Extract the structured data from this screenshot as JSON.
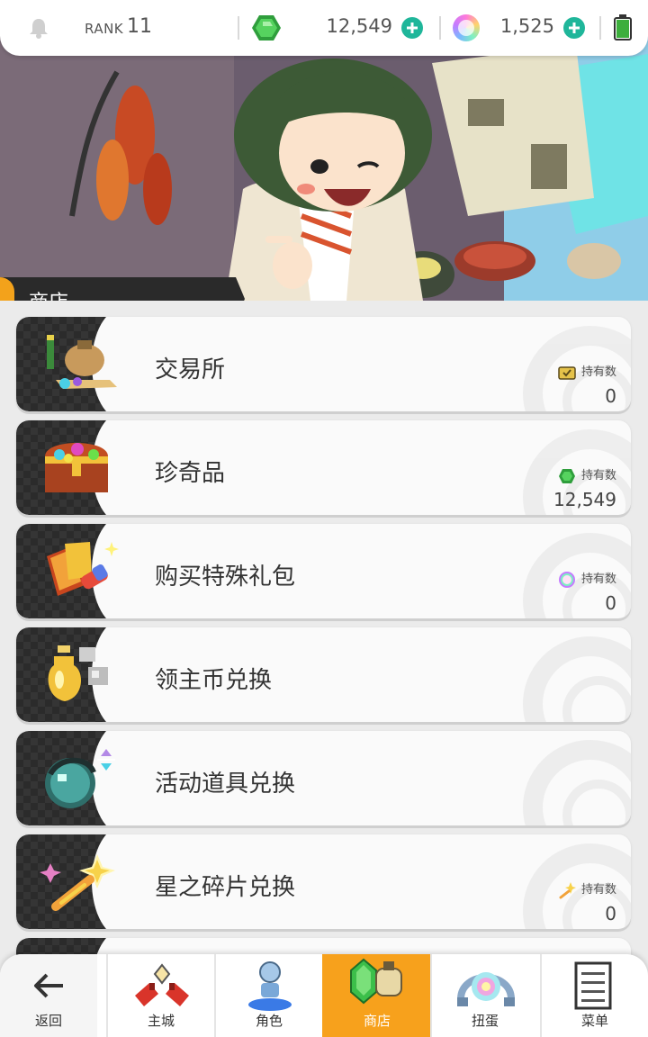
{
  "topbar": {
    "notification_icon": "bell-icon",
    "rank_label": "RANK",
    "rank_value": "11",
    "gems": "12,549",
    "orbs": "1,525",
    "battery_icon": "battery-charging-icon"
  },
  "banner": {
    "title": "商店"
  },
  "shop_items": [
    {
      "label": "交易所",
      "icon": "trade-bag-icon",
      "owned_label": "持有数",
      "owned_icon": "ticket-icon",
      "owned_value": "0"
    },
    {
      "label": "珍奇品",
      "icon": "treasure-chest-icon",
      "owned_label": "持有数",
      "owned_icon": "green-gem-icon",
      "owned_value": "12,549"
    },
    {
      "label": "购买特殊礼包",
      "icon": "special-pack-icon",
      "owned_label": "持有数",
      "owned_icon": "rainbow-orb-icon",
      "owned_value": "0"
    },
    {
      "label": "领主币兑换",
      "icon": "lord-coin-icon",
      "owned_label": "",
      "owned_icon": "",
      "owned_value": ""
    },
    {
      "label": "活动道具兑换",
      "icon": "event-item-icon",
      "owned_label": "",
      "owned_icon": "",
      "owned_value": ""
    },
    {
      "label": "星之碎片兑换",
      "icon": "star-shard-icon",
      "owned_label": "持有数",
      "owned_icon": "star-shard-small-icon",
      "owned_value": "0"
    }
  ],
  "nav": {
    "back": "返回",
    "home": "主城",
    "characters": "角色",
    "shop": "商店",
    "gacha": "扭蛋",
    "menu": "菜单"
  },
  "colors": {
    "accent_orange": "#f7a11c",
    "plus_green": "#1fb69a",
    "gem_green": "#3cbf4a"
  }
}
